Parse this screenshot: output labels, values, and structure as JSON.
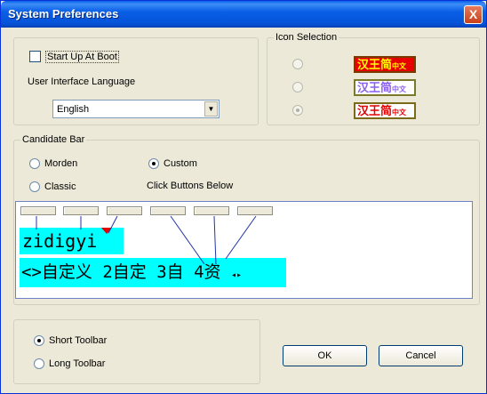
{
  "window": {
    "title": "System Preferences",
    "close_label": "X"
  },
  "general": {
    "startup_label": "Start Up At Boot",
    "startup_checked": false,
    "language_label": "User Interface Language",
    "language_value": "English"
  },
  "icon_selection": {
    "label": "Icon Selection",
    "options": [
      {
        "text": "汉王简",
        "small": "中文",
        "fg": "#ffff00",
        "bg": "#e60000",
        "border": "#7a3b00",
        "selected": false
      },
      {
        "text": "汉王简",
        "small": "中文",
        "fg": "#8d5ff0",
        "bg": "#ffffff",
        "border": "#7a7a2a",
        "selected": false
      },
      {
        "text": "汉王简",
        "small": "中文",
        "fg": "#e60000",
        "bg": "#ffffff",
        "border": "#7a6a1a",
        "selected": true
      }
    ]
  },
  "candidate_bar": {
    "label": "Candidate Bar",
    "morden_label": "Morden",
    "classic_label": "Classic",
    "custom_label": "Custom",
    "hint": "Click Buttons Below",
    "selected": "custom",
    "pinyin_text": "zidigyi",
    "candidates_text": "<>自定义 2自定 3自 4资",
    "scroll_arrows": "◂▸"
  },
  "toolbar": {
    "short_label": "Short Toolbar",
    "long_label": "Long Toolbar",
    "selected": "short"
  },
  "buttons": {
    "ok_label": "OK",
    "cancel_label": "Cancel"
  }
}
